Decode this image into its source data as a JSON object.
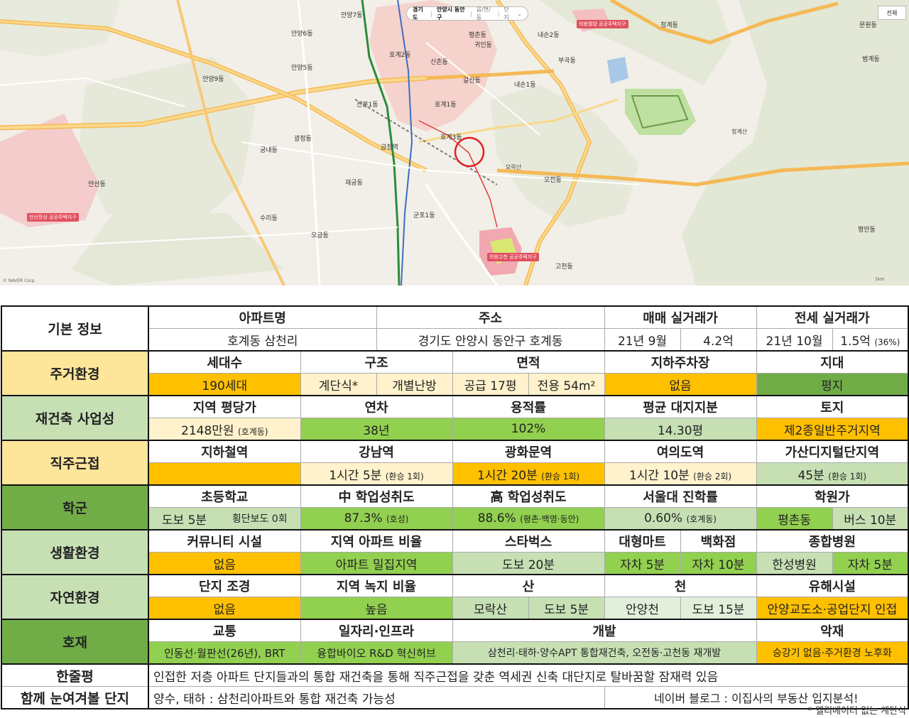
{
  "colors": {
    "orange": "#ffc000",
    "light_yellow": "#fff2cc",
    "yellow": "#fde59a",
    "green": "#70ad47",
    "mid_green": "#92d050",
    "light_green": "#c6e0b4",
    "pale_green": "#e2efda",
    "target_circle": "#e02020"
  },
  "map": {
    "search_bar": {
      "region": "경기도",
      "city": "안양시 동안구",
      "dong": "읍/면/동",
      "complex": "단지"
    },
    "full_button": "전체",
    "icon": "location-circle-icon",
    "dong_labels": [
      "안양7동",
      "안양6동",
      "안양5동",
      "호계2동",
      "신촌동",
      "갈산동",
      "귀인동",
      "평촌동",
      "내손2동",
      "내손1동",
      "청계동",
      "호계3동",
      "호계1동",
      "오전동",
      "산본1동",
      "궁내동",
      "재궁동",
      "수리동",
      "오금동",
      "금정역",
      "군포1동",
      "광정동",
      "고천동",
      "안양9동",
      "안산동",
      "부곡동",
      "청계산",
      "모락산",
      "범계동",
      "평안동",
      "문원동"
    ],
    "zone_labels": [
      "안산장상 공공주택지구",
      "의왕고천 공공주택지구",
      "의왕월암 공공주택지구"
    ],
    "copyright": "© NAVER Corp.",
    "scale": "1km"
  },
  "table": {
    "basic": {
      "category": "기본 정보",
      "headers": [
        "아파트명",
        "주소",
        "매매 실거래가",
        "전세 실거래가"
      ],
      "apartment": "호계동 삼천리",
      "address": "경기도 안양시 동안구 호계동",
      "sale_date": "21년 9월",
      "sale_price": "4.2억",
      "rent_date": "21년 10월",
      "rent_price": "1.5억",
      "rent_ratio": "(36%)"
    },
    "housing": {
      "category": "주거환경",
      "headers": [
        "세대수",
        "구조",
        "면적",
        "지하주차장",
        "지대"
      ],
      "households": "190세대",
      "structure_a": "계단식*",
      "structure_b": "개별난방",
      "area_a": "공급 17평",
      "area_b": "전용 54m²",
      "parking": "없음",
      "terrain": "평지"
    },
    "rebuild": {
      "category": "재건축 사업성",
      "headers": [
        "지역 평당가",
        "연차",
        "용적률",
        "평균 대지지분",
        "토지"
      ],
      "price": "2148만원",
      "price_note": "(호계동)",
      "age": "38년",
      "far": "102%",
      "land_share": "14.30평",
      "zoning": "제2종일반주거지역"
    },
    "commute": {
      "category": "직주근접",
      "headers": [
        "지하철역",
        "강남역",
        "광화문역",
        "여의도역",
        "가산디지털단지역"
      ],
      "subway": "",
      "gangnam": "1시간 5분",
      "gangnam_note": "(환승 1회)",
      "gwanghwamun": "1시간 20분",
      "gwanghwamun_note": "(환승 1회)",
      "yeouido": "1시간 10분",
      "yeouido_note": "(환승 2회)",
      "gasan": "45분",
      "gasan_note": "(환승 1회)"
    },
    "school": {
      "category": "학군",
      "headers": [
        "초등학교",
        "中 학업성취도",
        "高 학업성취도",
        "서울대 진학률",
        "학원가"
      ],
      "elem_a": "도보 5분",
      "elem_b": "횡단보도 0회",
      "middle": "87.3%",
      "middle_note": "(호성)",
      "high": "88.6%",
      "high_note": "(평촌·백영·동안)",
      "snu": "0.60%",
      "snu_note": "(호계동)",
      "academy_a": "평촌동",
      "academy_b": "버스 10분"
    },
    "living": {
      "category": "생활환경",
      "headers": [
        "커뮤니티 시설",
        "지역 아파트 비율",
        "스타벅스",
        "대형마트",
        "백화점",
        "종합병원"
      ],
      "community": "없음",
      "apt_ratio": "아파트 밀집지역",
      "starbucks": "도보 20분",
      "mart": "자차 5분",
      "dept": "자차 10분",
      "hospital_a": "한성병원",
      "hospital_b": "자차 5분"
    },
    "nature": {
      "category": "자연환경",
      "headers": [
        "단지 조경",
        "지역 녹지 비율",
        "산",
        "천",
        "유해시설"
      ],
      "landscape": "없음",
      "green_ratio": "높음",
      "mountain_a": "모락산",
      "mountain_b": "도보 5분",
      "stream_a": "안양천",
      "stream_b": "도보 15분",
      "hazard": "안양교도소·공업단지 인접"
    },
    "plans": {
      "category": "호재",
      "headers": [
        "교통",
        "일자리·인프라",
        "개발",
        "악재"
      ],
      "transport": "인동선·월판선(26년), BRT",
      "jobs": "융합바이오 R&D 혁신허브",
      "development": "삼천리·태하·양수APT 통합재건축, 오전동·고천동 재개발",
      "negatives": "승강기 없음·주거환경 노후화"
    },
    "summary": {
      "category": "한줄평",
      "text": "인접한 저층 아파트 단지들과의 통합 재건축을 통해 직주근접을 갖춘 역세권 신축 대단지로 탈바꿈할 잠재력 있음"
    },
    "watch": {
      "category": "함께 눈여겨볼 단지",
      "text": "양수, 태하 : 삼천리아파트와 통합 재건축 가능성",
      "source": "네이버 블로그 : 이집사의 부동산 입지분석!"
    }
  },
  "footnote": "* 엘리베이터 없는 계단식"
}
